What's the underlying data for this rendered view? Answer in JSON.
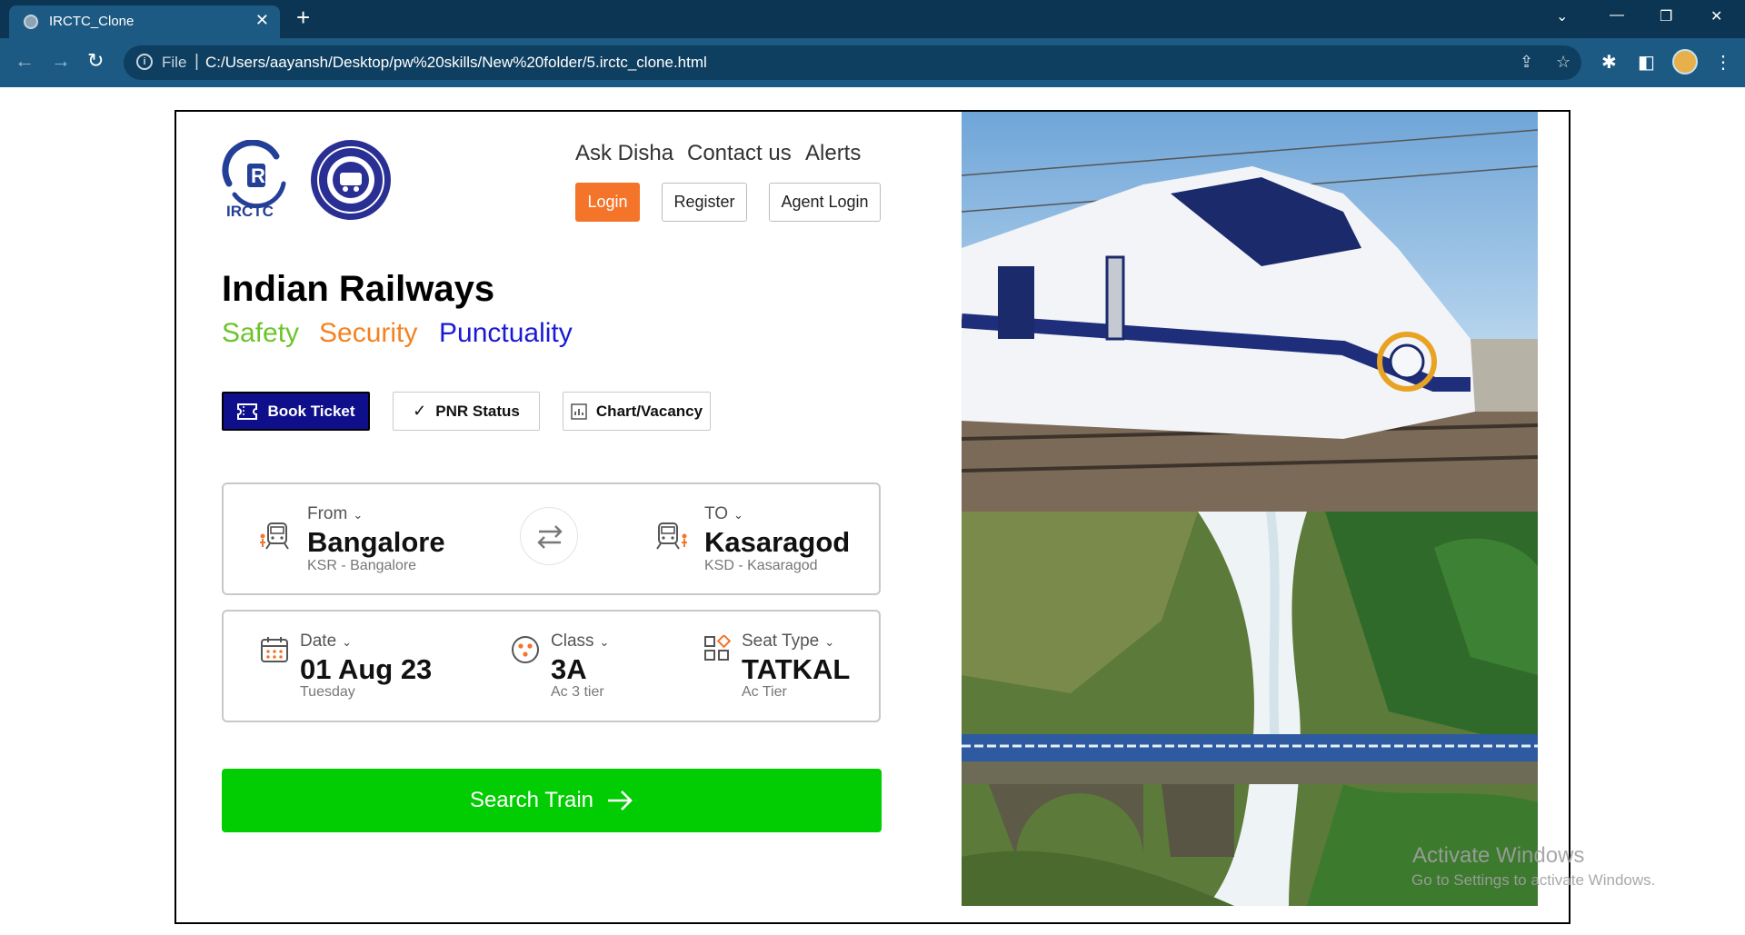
{
  "browser": {
    "tab_title": "IRCTC_Clone",
    "tab_close": "✕",
    "new_tab": "+",
    "address_scheme": "File",
    "address_url": "C:/Users/aayansh/Desktop/pw%20skills/New%20folder/5.irctc_clone.html"
  },
  "header": {
    "nav_links": [
      "Ask Disha",
      "Contact us",
      "Alerts"
    ],
    "buttons": {
      "login": "Login",
      "register": "Register",
      "agent_login": "Agent Login"
    },
    "logo_irctc_text": "IRCTC"
  },
  "hero": {
    "title": "Indian Railways",
    "taglines": [
      {
        "text": "Safety",
        "color": "#6cc42b"
      },
      {
        "text": "Security",
        "color": "#f5821f"
      },
      {
        "text": "Punctuality",
        "color": "#1a1ad6"
      }
    ]
  },
  "tabs": [
    {
      "label": "Book Ticket",
      "icon": "ticket-icon",
      "active": true
    },
    {
      "label": "PNR Status",
      "icon": "check-icon",
      "active": false
    },
    {
      "label": "Chart/Vacancy",
      "icon": "chart-icon",
      "active": false
    }
  ],
  "journey": {
    "from": {
      "label": "From",
      "value": "Bangalore",
      "sub": "KSR - Bangalore"
    },
    "to": {
      "label": "TO",
      "value": "Kasaragod",
      "sub": "KSD - Kasaragod"
    }
  },
  "details": {
    "date": {
      "label": "Date",
      "value": "01 Aug 23",
      "sub": "Tuesday"
    },
    "class": {
      "label": "Class",
      "value": "3A",
      "sub": "Ac 3 tier"
    },
    "seat_type": {
      "label": "Seat Type",
      "value": "TATKAL",
      "sub": "Ac Tier"
    }
  },
  "search": {
    "label": "Search Train"
  },
  "watermark": {
    "title": "Activate Windows",
    "subtitle": "Go to Settings to activate Windows."
  },
  "colors": {
    "accent_orange": "#f4742a",
    "primary_navy": "#0f0f8c",
    "search_green": "#02cc02",
    "browser_blue": "#1d5a83"
  }
}
